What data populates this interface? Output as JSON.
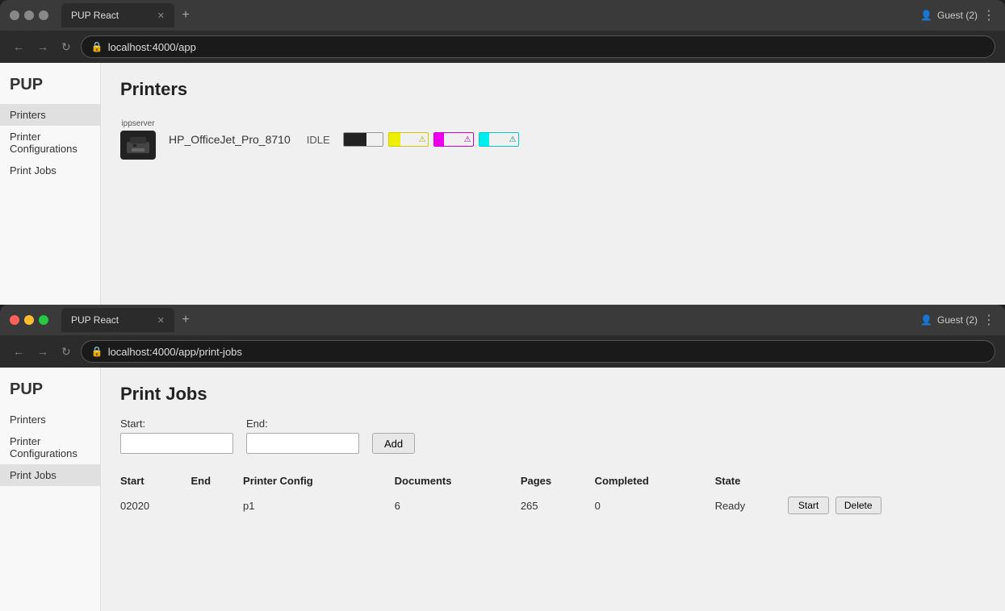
{
  "top_window": {
    "tab_title": "PUP React",
    "address": "localhost:4000/app",
    "account_label": "Guest (2)",
    "logo": "PUP",
    "nav_items": [
      {
        "label": "Printers",
        "href": "#",
        "active": true
      },
      {
        "label": "Printer Configurations",
        "href": "#",
        "active": false
      },
      {
        "label": "Print Jobs",
        "href": "#",
        "active": false
      }
    ],
    "page_title": "Printers",
    "printer": {
      "server_label": "ippserver",
      "name": "HP_OfficeJet_Pro_8710",
      "status": "IDLE"
    }
  },
  "bottom_window": {
    "tab_title": "PUP React",
    "address": "localhost:4000/app/print-jobs",
    "account_label": "Guest (2)",
    "logo": "PUP",
    "nav_items": [
      {
        "label": "Printers",
        "href": "#",
        "active": false
      },
      {
        "label": "Printer Configurations",
        "href": "#",
        "active": false
      },
      {
        "label": "Print Jobs",
        "href": "#",
        "active": true
      }
    ],
    "page_title": "Print Jobs",
    "form": {
      "start_label": "Start:",
      "end_label": "End:",
      "add_button": "Add"
    },
    "table": {
      "columns": [
        "Start",
        "End",
        "Printer Config",
        "Documents",
        "Pages",
        "Completed",
        "State"
      ],
      "rows": [
        {
          "start": "02020",
          "end": "",
          "printer_config": "p1",
          "documents": "6",
          "pages": "265",
          "completed": "0",
          "state": "Ready",
          "start_btn": "Start",
          "delete_btn": "Delete"
        }
      ]
    }
  }
}
